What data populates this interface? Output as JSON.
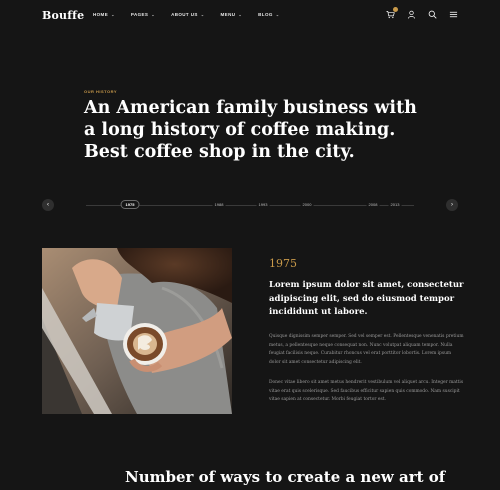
{
  "brand": {
    "logo": "Bouffe"
  },
  "nav": {
    "items": [
      {
        "label": "HOME"
      },
      {
        "label": "PAGES"
      },
      {
        "label": "ABOUT US"
      },
      {
        "label": "MENU"
      },
      {
        "label": "BLOG"
      }
    ],
    "icons": [
      "cart-icon",
      "user-icon",
      "search-icon",
      "menu-icon"
    ],
    "accent": "#c99a4a"
  },
  "hero": {
    "eyebrow": "OUR HISTORY",
    "headline": "An American family business with a long history of coffee making. Best coffee shop in the city."
  },
  "timeline": {
    "years": [
      {
        "label": "1975",
        "active": true
      },
      {
        "label": "1988",
        "active": false
      },
      {
        "label": "1993",
        "active": false
      },
      {
        "label": "2000",
        "active": false
      },
      {
        "label": "2008",
        "active": false
      },
      {
        "label": "2013",
        "active": false
      }
    ]
  },
  "story": {
    "year": "1975",
    "lead": "Lorem ipsum dolor sit amet, consectetur adipiscing elit, sed do eiusmod tempor incididunt ut labore.",
    "paragraph1": "Quisque dignissim semper semper. Sed vel semper est. Pellentesque venenatis pretium metus, a pellentesque neque consequat non. Nunc volutpat aliquam tempor. Nulla feugiat facilisis neque. Curabitur rhoncus vel erat porttitor lobortis. Lorem ipsum dolor sit amet consectetur adipiscing elit.",
    "paragraph2": "Donec vitae libero sit amet metus hendrerit vestibulum vel aliquet arcu. Integer mattis vitae erat quis scelerisque. Sed faucibus efficitur sapien quis commodo. Nam suscipit vitae sapien at consectetur. Morbi feugiat tortor est."
  },
  "section": {
    "title": "Number of ways to create a new art of"
  },
  "colors": {
    "background": "#151515",
    "accent": "#c99a4a",
    "text": "#ffffff",
    "muted": "#9a9a9a"
  }
}
